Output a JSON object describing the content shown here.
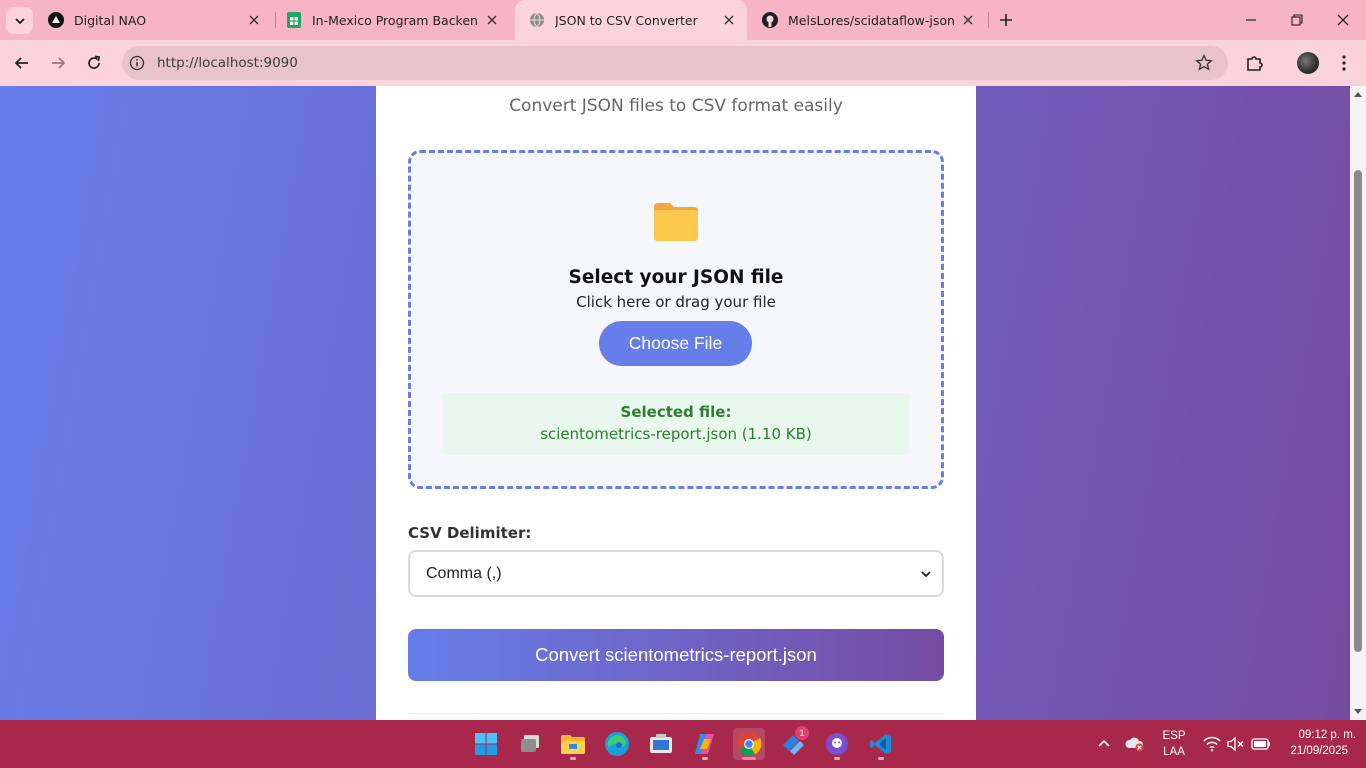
{
  "browser": {
    "tabs": [
      {
        "title": "Digital NAO",
        "icon": "triangle-logo-icon",
        "active": false
      },
      {
        "title": "In-Mexico Program Backend Gp",
        "icon": "google-sheets-icon",
        "active": false
      },
      {
        "title": "JSON to CSV Converter",
        "icon": "globe-icon",
        "active": true
      },
      {
        "title": "MelsLores/scidataflow-json-csv",
        "icon": "github-icon",
        "active": false
      }
    ],
    "address": "http://localhost:9090"
  },
  "page": {
    "subtitle": "Convert JSON files to CSV format easily",
    "dropzone": {
      "icon": "folder-icon",
      "title": "Select your JSON file",
      "hint": "Click here or drag your file",
      "button": "Choose File"
    },
    "selected": {
      "label": "Selected file:",
      "name": "scientometrics-report.json (1.10 KB)"
    },
    "delimiter": {
      "label": "CSV Delimiter:",
      "value": "Comma (,)"
    },
    "convert_button": "Convert scientometrics-report.json",
    "colors": {
      "accent": "#667eea",
      "accent_end": "#764ba2",
      "success": "#2e7d32"
    }
  },
  "taskbar": {
    "apps": [
      "windows-start-icon",
      "task-view-icon",
      "file-explorer-icon",
      "edge-icon",
      "snipping-tool-icon",
      "copilot-icon",
      "chrome-icon",
      "power-automate-icon",
      "github-desktop-icon",
      "vscode-icon"
    ],
    "notification_badge": "1",
    "language_line1": "ESP",
    "language_line2": "LAA",
    "time": "09:12 p. m.",
    "date": "21/09/2025"
  }
}
